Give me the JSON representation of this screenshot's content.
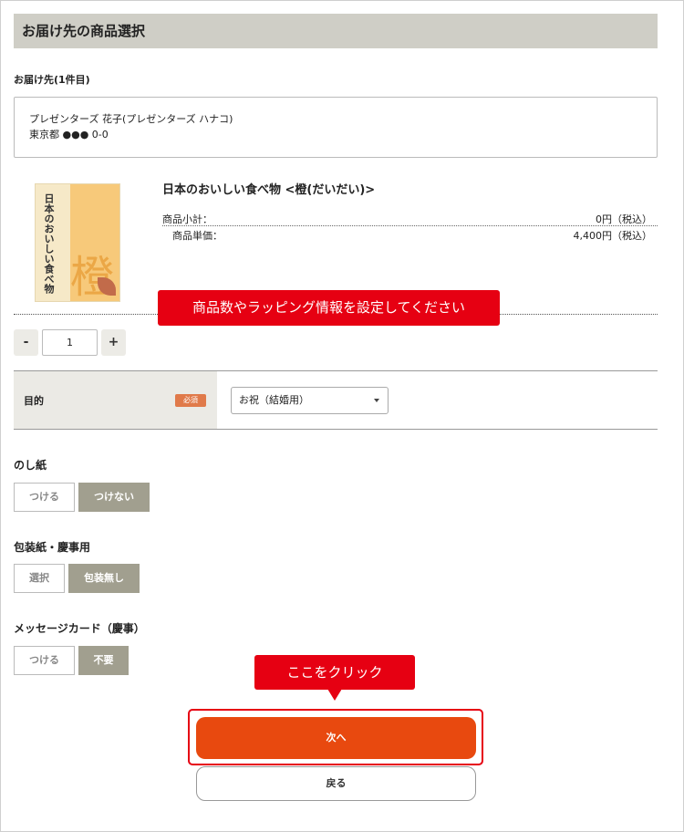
{
  "header": {
    "title": "お届け先の商品選択"
  },
  "destination": {
    "label": "お届け先(1件目)",
    "name": "プレゼンターズ 花子(プレゼンターズ ハナコ)",
    "address": "東京都 ●●● 0-0"
  },
  "product": {
    "name": "日本のおいしい食べ物 <橙(だいだい)>",
    "image_text": "日本のおいしい食べ物",
    "image_kanji": "橙",
    "subtotal_label": "商品小計：",
    "subtotal_value": "0円（税込）",
    "unit_price_label": "商品単価：",
    "unit_price_value": "4,400円（税込）"
  },
  "quantity": {
    "minus": "-",
    "value": "1",
    "plus": "+"
  },
  "annotations": {
    "settings_banner": "商品数やラッピング情報を設定してください",
    "click_banner": "ここをクリック"
  },
  "purpose": {
    "label": "目的",
    "required": "必須",
    "selected": "お祝（結婚用）"
  },
  "noshi": {
    "heading": "のし紙",
    "options": [
      "つける",
      "つけない"
    ],
    "selected": "つけない"
  },
  "wrapping": {
    "heading": "包装紙・慶事用",
    "options": [
      "選択",
      "包装無し"
    ],
    "selected": "包装無し"
  },
  "message_card": {
    "heading": "メッセージカード（慶事）",
    "options": [
      "つける",
      "不要"
    ],
    "selected": "不要"
  },
  "actions": {
    "next": "次へ",
    "back": "戻る"
  },
  "colors": {
    "header_bg": "#cfcec6",
    "accent": "#e8490f",
    "banner": "#e60012",
    "active_option": "#a19f8f",
    "required_badge": "#e07a4a"
  }
}
